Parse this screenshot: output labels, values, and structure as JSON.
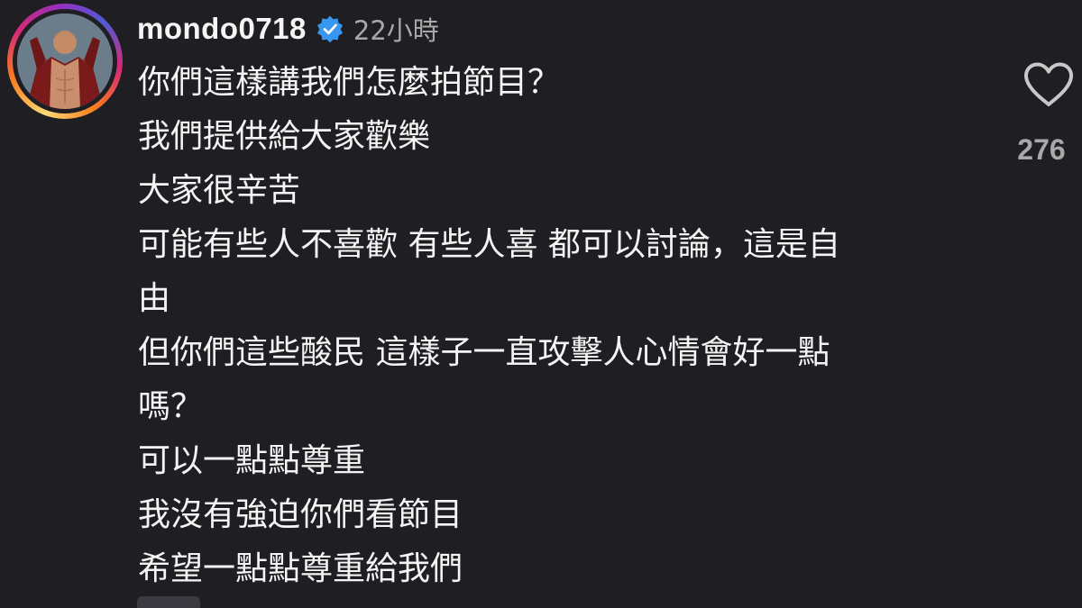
{
  "comment": {
    "username": "mondo0718",
    "verified": true,
    "timestamp": "22小時",
    "lines": [
      "你們這樣講我們怎麼拍節目？",
      "我們提供給大家歡樂",
      "大家很辛苦",
      "可能有些人不喜歡 有些人喜 都可以討論，這是自",
      "由",
      "但你們這些酸民 這樣子一直攻擊人心情會好一點",
      "嗎？",
      "可以一點點尊重",
      "我沒有強迫你們看節目",
      "希望一點點尊重給我們"
    ],
    "like_icon": "heart-outline-icon",
    "like_count": "276"
  },
  "colors": {
    "background": "#1f1f23",
    "text": "#f5f5f5",
    "muted": "#a8a8a8",
    "verified_badge": "#3797f0"
  }
}
